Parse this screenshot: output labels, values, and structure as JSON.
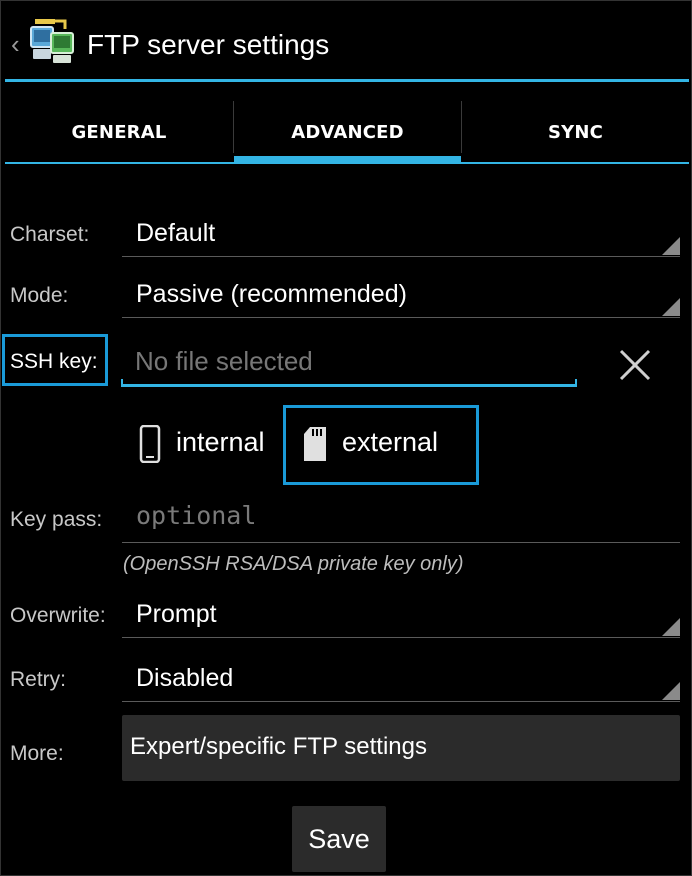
{
  "header": {
    "title": "FTP server settings",
    "back_icon": "chevron-left-icon",
    "app_icon": "ftp-app-icon"
  },
  "tabs": [
    {
      "label": "GENERAL",
      "selected": false
    },
    {
      "label": "ADVANCED",
      "selected": true
    },
    {
      "label": "SYNC",
      "selected": false
    }
  ],
  "form": {
    "charset": {
      "label": "Charset:",
      "value": "Default"
    },
    "mode": {
      "label": "Mode:",
      "value": "Passive (recommended)"
    },
    "ssh_key": {
      "label": "SSH key:",
      "placeholder": "No file selected",
      "clear_icon": "close-icon"
    },
    "storage": {
      "internal": {
        "label": "internal",
        "icon": "phone-icon"
      },
      "external": {
        "label": "external",
        "icon": "sd-card-icon"
      }
    },
    "key_pass": {
      "label": "Key pass:",
      "placeholder": "optional",
      "hint": "(OpenSSH RSA/DSA private key only)"
    },
    "overwrite": {
      "label": "Overwrite:",
      "value": "Prompt"
    },
    "retry": {
      "label": "Retry:",
      "value": "Disabled"
    },
    "more": {
      "label": "More:",
      "button_label": "Expert/specific FTP settings"
    }
  },
  "save_label": "Save",
  "colors": {
    "accent": "#33b5e5",
    "highlight_box": "#1a9ad8",
    "background": "#000000",
    "button_bg": "#2b2b2b"
  }
}
